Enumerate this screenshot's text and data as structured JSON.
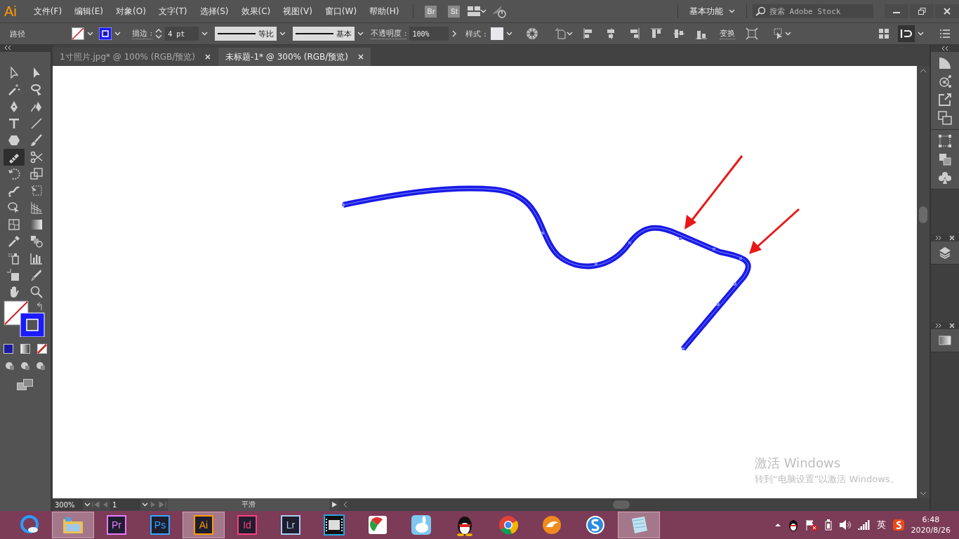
{
  "menu_bar": {
    "logo": "Ai",
    "menus": [
      "文件(F)",
      "编辑(E)",
      "对象(O)",
      "文字(T)",
      "选择(S)",
      "效果(C)",
      "视图(V)",
      "窗口(W)",
      "帮助(H)"
    ],
    "bridge": "Br",
    "stock": "St",
    "workspace": "基本功能",
    "search_placeholder": "搜索 Adobe Stock"
  },
  "control_bar": {
    "selection_label": "路径",
    "stroke_label": "描边 :",
    "stroke_weight": "4 pt",
    "stroke_profile": "等比",
    "brush": "基本",
    "opacity_label": "不透明度 :",
    "opacity": "100%",
    "style_label": "样式 :",
    "transform_label": "变换"
  },
  "tabs": [
    {
      "label": "1寸照片.jpg* @ 100% (RGB/预览)",
      "selected": false
    },
    {
      "label": "未标题-1* @ 300% (RGB/预览)",
      "selected": true
    }
  ],
  "toolbox": {
    "tools": [
      {
        "selected": false
      },
      {
        "selected": false
      },
      {
        "selected": false
      },
      {
        "selected": false
      },
      {
        "selected": false
      },
      {
        "selected": false
      },
      {
        "selected": false
      },
      {
        "selected": false
      },
      {
        "selected": false
      },
      {
        "selected": false
      },
      {
        "selected": true
      },
      {
        "selected": false
      },
      {
        "selected": false
      },
      {
        "selected": false
      },
      {
        "selected": false
      },
      {
        "selected": false
      },
      {
        "selected": false
      },
      {
        "selected": false
      },
      {
        "selected": false
      },
      {
        "selected": false
      },
      {
        "selected": false
      },
      {
        "selected": false
      },
      {
        "selected": false
      },
      {
        "selected": false
      },
      {
        "selected": false
      },
      {
        "selected": false
      },
      {
        "selected": false
      },
      {
        "selected": false
      }
    ]
  },
  "activation_notice": {
    "title": "激活 Windows",
    "message": "转到“电脑设置”以激活 Windows。"
  },
  "status_bar": {
    "zoom": "300%",
    "artboard": "1",
    "tool_name": "平滑"
  },
  "taskbar": {
    "apps": [
      {
        "kind": "browser",
        "open": false
      },
      {
        "kind": "folder",
        "open": true
      },
      {
        "kind": "badge",
        "label": "Pr",
        "color": "#e77bff",
        "open": false
      },
      {
        "kind": "badge",
        "label": "Ps",
        "color": "#31a8ff",
        "open": false
      },
      {
        "kind": "badge",
        "label": "Ai",
        "color": "#ff9a00",
        "open": true
      },
      {
        "kind": "badge",
        "label": "Id",
        "color": "#ff3f80",
        "open": false
      },
      {
        "kind": "badge",
        "label": "Lr",
        "color": "#a9cff0",
        "open": false
      },
      {
        "kind": "film",
        "open": false
      },
      {
        "kind": "pie",
        "open": false
      },
      {
        "kind": "cloud",
        "open": false
      },
      {
        "kind": "penguin",
        "open": false
      },
      {
        "kind": "chrome",
        "open": false
      },
      {
        "kind": "fox",
        "open": false
      },
      {
        "kind": "sogou",
        "open": false
      },
      {
        "kind": "notepad",
        "open": true
      }
    ],
    "input_language": "英",
    "time": "6:48",
    "date": "2020/8/26"
  }
}
